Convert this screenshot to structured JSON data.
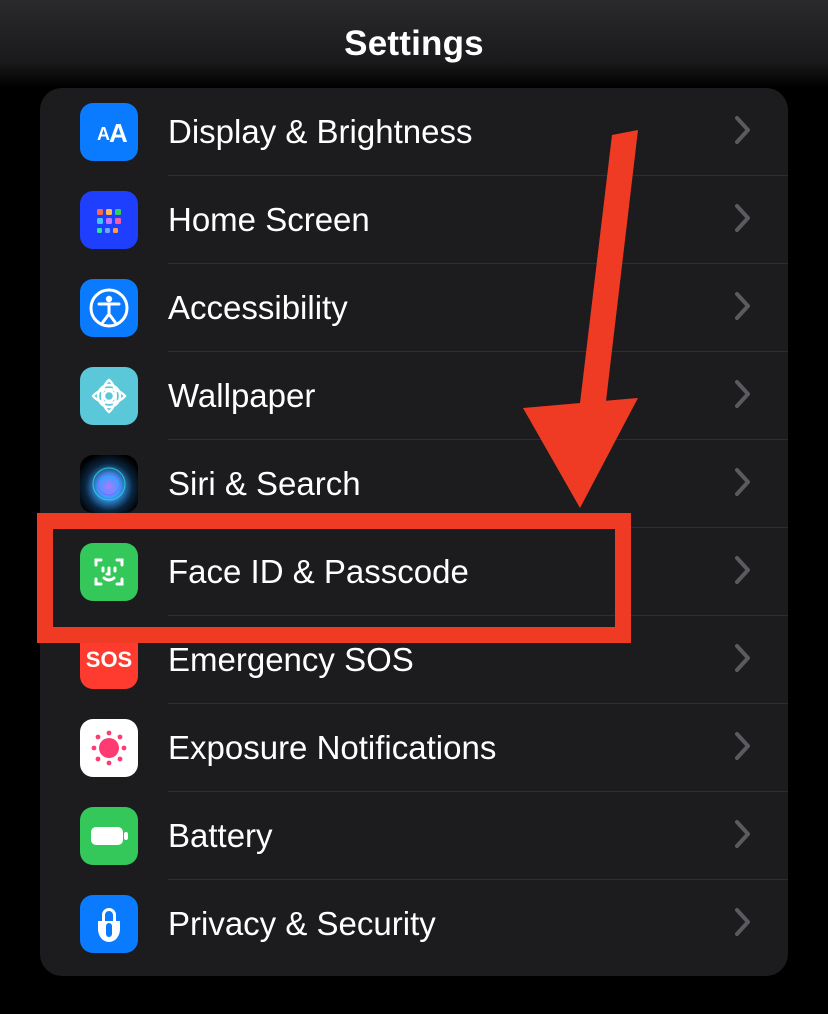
{
  "header": {
    "title": "Settings"
  },
  "rows": [
    {
      "label": "Display & Brightness"
    },
    {
      "label": "Home Screen"
    },
    {
      "label": "Accessibility"
    },
    {
      "label": "Wallpaper"
    },
    {
      "label": "Siri & Search"
    },
    {
      "label": "Face ID & Passcode"
    },
    {
      "label": "Emergency SOS"
    },
    {
      "label": "Exposure Notifications"
    },
    {
      "label": "Battery"
    },
    {
      "label": "Privacy & Security"
    }
  ],
  "annotation": {
    "highlighted_row_index": 5,
    "highlight_color": "#ef3a24"
  }
}
